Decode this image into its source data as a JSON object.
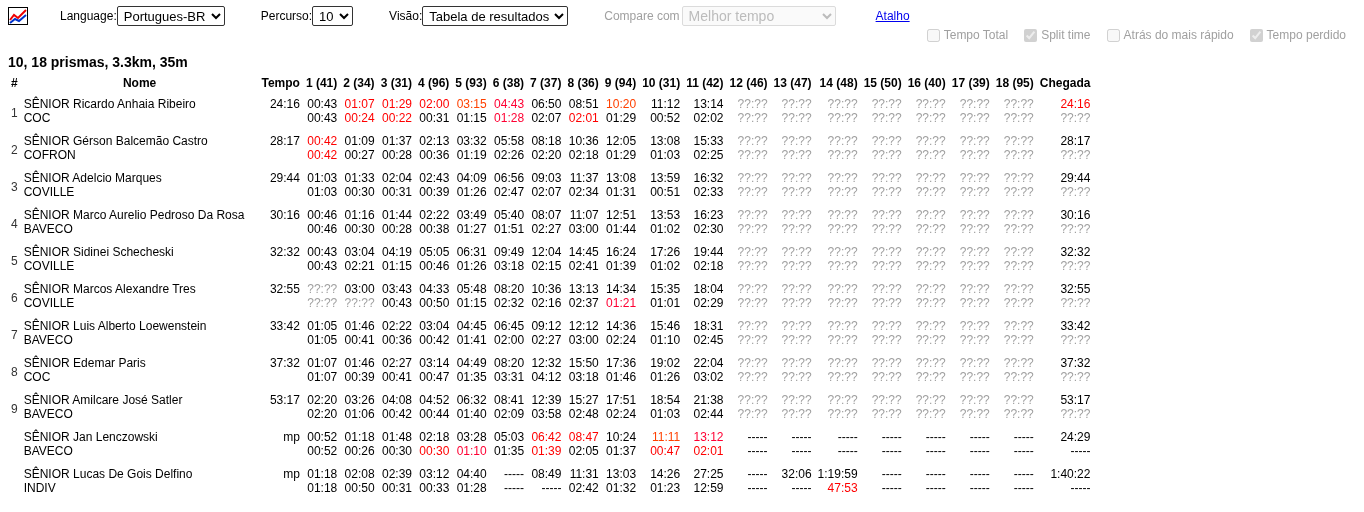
{
  "toolbar": {
    "language": {
      "label": "Language:",
      "value": "Portugues-BR"
    },
    "course": {
      "label": "Percurso:",
      "value": "10"
    },
    "view": {
      "label": "Visão:",
      "value": "Tabela de resultados"
    },
    "compare": {
      "label": "Compare com",
      "value": "Melhor tempo",
      "disabled": true
    },
    "link": "Atalho"
  },
  "options": [
    {
      "label": "Tempo Total",
      "checked": false,
      "disabled": true
    },
    {
      "label": "Split time",
      "checked": true,
      "disabled": true
    },
    {
      "label": "Atrás do mais rápido",
      "checked": false,
      "disabled": true
    },
    {
      "label": "Tempo perdido",
      "checked": true,
      "disabled": true
    }
  ],
  "course_title": "10, 18 prismas, 3.3km, 35m",
  "table": {
    "columns": [
      "#",
      "Nome",
      "Tempo",
      "1 (41)",
      "2 (34)",
      "3 (31)",
      "4 (96)",
      "5 (93)",
      "6 (38)",
      "7 (37)",
      "8 (36)",
      "9 (94)",
      "10 (31)",
      "11 (42)",
      "12 (46)",
      "13 (47)",
      "14 (48)",
      "15 (50)",
      "16 (40)",
      "17 (39)",
      "18 (95)",
      "Chegada"
    ],
    "rows": [
      {
        "rank": "1",
        "name": "SÊNIOR Ricardo Anhaia Ribeiro",
        "club": "COC",
        "time": "24:16",
        "splits": [
          [
            "00:43",
            "00:43"
          ],
          [
            {
              "text": "01:07",
              "color": "#ff0000"
            },
            {
              "text": "00:24",
              "color": "#ff0000"
            }
          ],
          [
            {
              "text": "01:29",
              "color": "#ff0000"
            },
            {
              "text": "00:22",
              "color": "#ff0000"
            }
          ],
          [
            {
              "text": "02:00",
              "color": "#ff0000"
            },
            "00:31"
          ],
          [
            {
              "text": "03:15",
              "color": "#ff4000"
            },
            "01:15"
          ],
          [
            {
              "text": "04:43",
              "color": "#ff0033"
            },
            {
              "text": "01:28",
              "color": "#ff0033"
            }
          ],
          [
            "06:50",
            "02:07"
          ],
          [
            "08:51",
            {
              "text": "02:01",
              "color": "#ff0000"
            }
          ],
          [
            {
              "text": "10:20",
              "color": "#ff4000"
            },
            "01:29"
          ],
          [
            "11:12",
            "00:52"
          ],
          [
            "13:14",
            "02:02"
          ],
          [
            {
              "text": "??:??",
              "color": "#a0a0a0"
            },
            {
              "text": "??:??",
              "color": "#a0a0a0"
            }
          ],
          [
            {
              "text": "??:??",
              "color": "#a0a0a0"
            },
            {
              "text": "??:??",
              "color": "#a0a0a0"
            }
          ],
          [
            {
              "text": "??:??",
              "color": "#a0a0a0"
            },
            {
              "text": "??:??",
              "color": "#a0a0a0"
            }
          ],
          [
            {
              "text": "??:??",
              "color": "#a0a0a0"
            },
            {
              "text": "??:??",
              "color": "#a0a0a0"
            }
          ],
          [
            {
              "text": "??:??",
              "color": "#a0a0a0"
            },
            {
              "text": "??:??",
              "color": "#a0a0a0"
            }
          ],
          [
            {
              "text": "??:??",
              "color": "#a0a0a0"
            },
            {
              "text": "??:??",
              "color": "#a0a0a0"
            }
          ],
          [
            {
              "text": "??:??",
              "color": "#a0a0a0"
            },
            {
              "text": "??:??",
              "color": "#a0a0a0"
            }
          ],
          [
            {
              "text": "24:16",
              "color": "#ff0000"
            },
            {
              "text": "??:??",
              "color": "#a0a0a0"
            }
          ]
        ]
      },
      {
        "rank": "2",
        "name": "SÊNIOR Gérson Balcemão Castro",
        "club": "COFRON",
        "time": "28:17",
        "splits": [
          [
            {
              "text": "00:42",
              "color": "#ff0000"
            },
            {
              "text": "00:42",
              "color": "#ff0000"
            }
          ],
          [
            "01:09",
            "00:27"
          ],
          [
            "01:37",
            "00:28"
          ],
          [
            "02:13",
            "00:36"
          ],
          [
            "03:32",
            "01:19"
          ],
          [
            "05:58",
            "02:26"
          ],
          [
            "08:18",
            "02:20"
          ],
          [
            "10:36",
            "02:18"
          ],
          [
            "12:05",
            "01:29"
          ],
          [
            "13:08",
            "01:03"
          ],
          [
            "15:33",
            "02:25"
          ],
          [
            {
              "text": "??:??",
              "color": "#a0a0a0"
            },
            {
              "text": "??:??",
              "color": "#a0a0a0"
            }
          ],
          [
            {
              "text": "??:??",
              "color": "#a0a0a0"
            },
            {
              "text": "??:??",
              "color": "#a0a0a0"
            }
          ],
          [
            {
              "text": "??:??",
              "color": "#a0a0a0"
            },
            {
              "text": "??:??",
              "color": "#a0a0a0"
            }
          ],
          [
            {
              "text": "??:??",
              "color": "#a0a0a0"
            },
            {
              "text": "??:??",
              "color": "#a0a0a0"
            }
          ],
          [
            {
              "text": "??:??",
              "color": "#a0a0a0"
            },
            {
              "text": "??:??",
              "color": "#a0a0a0"
            }
          ],
          [
            {
              "text": "??:??",
              "color": "#a0a0a0"
            },
            {
              "text": "??:??",
              "color": "#a0a0a0"
            }
          ],
          [
            {
              "text": "??:??",
              "color": "#a0a0a0"
            },
            {
              "text": "??:??",
              "color": "#a0a0a0"
            }
          ],
          [
            "28:17",
            {
              "text": "??:??",
              "color": "#a0a0a0"
            }
          ]
        ]
      },
      {
        "rank": "3",
        "name": "SÊNIOR Adelcio Marques",
        "club": "COVILLE",
        "time": "29:44",
        "splits": [
          [
            "01:03",
            "01:03"
          ],
          [
            "01:33",
            "00:30"
          ],
          [
            "02:04",
            "00:31"
          ],
          [
            "02:43",
            "00:39"
          ],
          [
            "04:09",
            "01:26"
          ],
          [
            "06:56",
            "02:47"
          ],
          [
            "09:03",
            "02:07"
          ],
          [
            "11:37",
            "02:34"
          ],
          [
            "13:08",
            "01:31"
          ],
          [
            "13:59",
            "00:51"
          ],
          [
            "16:32",
            "02:33"
          ],
          [
            {
              "text": "??:??",
              "color": "#a0a0a0"
            },
            {
              "text": "??:??",
              "color": "#a0a0a0"
            }
          ],
          [
            {
              "text": "??:??",
              "color": "#a0a0a0"
            },
            {
              "text": "??:??",
              "color": "#a0a0a0"
            }
          ],
          [
            {
              "text": "??:??",
              "color": "#a0a0a0"
            },
            {
              "text": "??:??",
              "color": "#a0a0a0"
            }
          ],
          [
            {
              "text": "??:??",
              "color": "#a0a0a0"
            },
            {
              "text": "??:??",
              "color": "#a0a0a0"
            }
          ],
          [
            {
              "text": "??:??",
              "color": "#a0a0a0"
            },
            {
              "text": "??:??",
              "color": "#a0a0a0"
            }
          ],
          [
            {
              "text": "??:??",
              "color": "#a0a0a0"
            },
            {
              "text": "??:??",
              "color": "#a0a0a0"
            }
          ],
          [
            {
              "text": "??:??",
              "color": "#a0a0a0"
            },
            {
              "text": "??:??",
              "color": "#a0a0a0"
            }
          ],
          [
            "29:44",
            {
              "text": "??:??",
              "color": "#a0a0a0"
            }
          ]
        ]
      },
      {
        "rank": "4",
        "name": "SÊNIOR Marco Aurelio Pedroso Da Rosa",
        "club": "BAVECO",
        "time": "30:16",
        "splits": [
          [
            "00:46",
            "00:46"
          ],
          [
            "01:16",
            "00:30"
          ],
          [
            "01:44",
            "00:28"
          ],
          [
            "02:22",
            "00:38"
          ],
          [
            "03:49",
            "01:27"
          ],
          [
            "05:40",
            "01:51"
          ],
          [
            "08:07",
            "02:27"
          ],
          [
            "11:07",
            "03:00"
          ],
          [
            "12:51",
            "01:44"
          ],
          [
            "13:53",
            "01:02"
          ],
          [
            "16:23",
            "02:30"
          ],
          [
            {
              "text": "??:??",
              "color": "#a0a0a0"
            },
            {
              "text": "??:??",
              "color": "#a0a0a0"
            }
          ],
          [
            {
              "text": "??:??",
              "color": "#a0a0a0"
            },
            {
              "text": "??:??",
              "color": "#a0a0a0"
            }
          ],
          [
            {
              "text": "??:??",
              "color": "#a0a0a0"
            },
            {
              "text": "??:??",
              "color": "#a0a0a0"
            }
          ],
          [
            {
              "text": "??:??",
              "color": "#a0a0a0"
            },
            {
              "text": "??:??",
              "color": "#a0a0a0"
            }
          ],
          [
            {
              "text": "??:??",
              "color": "#a0a0a0"
            },
            {
              "text": "??:??",
              "color": "#a0a0a0"
            }
          ],
          [
            {
              "text": "??:??",
              "color": "#a0a0a0"
            },
            {
              "text": "??:??",
              "color": "#a0a0a0"
            }
          ],
          [
            {
              "text": "??:??",
              "color": "#a0a0a0"
            },
            {
              "text": "??:??",
              "color": "#a0a0a0"
            }
          ],
          [
            "30:16",
            {
              "text": "??:??",
              "color": "#a0a0a0"
            }
          ]
        ]
      },
      {
        "rank": "5",
        "name": "SÊNIOR Sidinei Schecheski",
        "club": "COVILLE",
        "time": "32:32",
        "splits": [
          [
            "00:43",
            "00:43"
          ],
          [
            "03:04",
            "02:21"
          ],
          [
            "04:19",
            "01:15"
          ],
          [
            "05:05",
            "00:46"
          ],
          [
            "06:31",
            "01:26"
          ],
          [
            "09:49",
            "03:18"
          ],
          [
            "12:04",
            "02:15"
          ],
          [
            "14:45",
            "02:41"
          ],
          [
            "16:24",
            "01:39"
          ],
          [
            "17:26",
            "01:02"
          ],
          [
            "19:44",
            "02:18"
          ],
          [
            {
              "text": "??:??",
              "color": "#a0a0a0"
            },
            {
              "text": "??:??",
              "color": "#a0a0a0"
            }
          ],
          [
            {
              "text": "??:??",
              "color": "#a0a0a0"
            },
            {
              "text": "??:??",
              "color": "#a0a0a0"
            }
          ],
          [
            {
              "text": "??:??",
              "color": "#a0a0a0"
            },
            {
              "text": "??:??",
              "color": "#a0a0a0"
            }
          ],
          [
            {
              "text": "??:??",
              "color": "#a0a0a0"
            },
            {
              "text": "??:??",
              "color": "#a0a0a0"
            }
          ],
          [
            {
              "text": "??:??",
              "color": "#a0a0a0"
            },
            {
              "text": "??:??",
              "color": "#a0a0a0"
            }
          ],
          [
            {
              "text": "??:??",
              "color": "#a0a0a0"
            },
            {
              "text": "??:??",
              "color": "#a0a0a0"
            }
          ],
          [
            {
              "text": "??:??",
              "color": "#a0a0a0"
            },
            {
              "text": "??:??",
              "color": "#a0a0a0"
            }
          ],
          [
            "32:32",
            {
              "text": "??:??",
              "color": "#a0a0a0"
            }
          ]
        ]
      },
      {
        "rank": "6",
        "name": "SÊNIOR Marcos Alexandre Tres",
        "club": "COVILLE",
        "time": "32:55",
        "splits": [
          [
            {
              "text": "??:??",
              "color": "#a0a0a0"
            },
            {
              "text": "??:??",
              "color": "#a0a0a0"
            }
          ],
          [
            "03:00",
            {
              "text": "??:??",
              "color": "#a0a0a0"
            }
          ],
          [
            "03:43",
            "00:43"
          ],
          [
            "04:33",
            "00:50"
          ],
          [
            "05:48",
            "01:15"
          ],
          [
            "08:20",
            "02:32"
          ],
          [
            "10:36",
            "02:16"
          ],
          [
            "13:13",
            "02:37"
          ],
          [
            "14:34",
            {
              "text": "01:21",
              "color": "#ff0033"
            }
          ],
          [
            "15:35",
            "01:01"
          ],
          [
            "18:04",
            "02:29"
          ],
          [
            {
              "text": "??:??",
              "color": "#a0a0a0"
            },
            {
              "text": "??:??",
              "color": "#a0a0a0"
            }
          ],
          [
            {
              "text": "??:??",
              "color": "#a0a0a0"
            },
            {
              "text": "??:??",
              "color": "#a0a0a0"
            }
          ],
          [
            {
              "text": "??:??",
              "color": "#a0a0a0"
            },
            {
              "text": "??:??",
              "color": "#a0a0a0"
            }
          ],
          [
            {
              "text": "??:??",
              "color": "#a0a0a0"
            },
            {
              "text": "??:??",
              "color": "#a0a0a0"
            }
          ],
          [
            {
              "text": "??:??",
              "color": "#a0a0a0"
            },
            {
              "text": "??:??",
              "color": "#a0a0a0"
            }
          ],
          [
            {
              "text": "??:??",
              "color": "#a0a0a0"
            },
            {
              "text": "??:??",
              "color": "#a0a0a0"
            }
          ],
          [
            {
              "text": "??:??",
              "color": "#a0a0a0"
            },
            {
              "text": "??:??",
              "color": "#a0a0a0"
            }
          ],
          [
            "32:55",
            {
              "text": "??:??",
              "color": "#a0a0a0"
            }
          ]
        ]
      },
      {
        "rank": "7",
        "name": "SÊNIOR Luis Alberto Loewenstein",
        "club": "BAVECO",
        "time": "33:42",
        "splits": [
          [
            "01:05",
            "01:05"
          ],
          [
            "01:46",
            "00:41"
          ],
          [
            "02:22",
            "00:36"
          ],
          [
            "03:04",
            "00:42"
          ],
          [
            "04:45",
            "01:41"
          ],
          [
            "06:45",
            "02:00"
          ],
          [
            "09:12",
            "02:27"
          ],
          [
            "12:12",
            "03:00"
          ],
          [
            "14:36",
            "02:24"
          ],
          [
            "15:46",
            "01:10"
          ],
          [
            "18:31",
            "02:45"
          ],
          [
            {
              "text": "??:??",
              "color": "#a0a0a0"
            },
            {
              "text": "??:??",
              "color": "#a0a0a0"
            }
          ],
          [
            {
              "text": "??:??",
              "color": "#a0a0a0"
            },
            {
              "text": "??:??",
              "color": "#a0a0a0"
            }
          ],
          [
            {
              "text": "??:??",
              "color": "#a0a0a0"
            },
            {
              "text": "??:??",
              "color": "#a0a0a0"
            }
          ],
          [
            {
              "text": "??:??",
              "color": "#a0a0a0"
            },
            {
              "text": "??:??",
              "color": "#a0a0a0"
            }
          ],
          [
            {
              "text": "??:??",
              "color": "#a0a0a0"
            },
            {
              "text": "??:??",
              "color": "#a0a0a0"
            }
          ],
          [
            {
              "text": "??:??",
              "color": "#a0a0a0"
            },
            {
              "text": "??:??",
              "color": "#a0a0a0"
            }
          ],
          [
            {
              "text": "??:??",
              "color": "#a0a0a0"
            },
            {
              "text": "??:??",
              "color": "#a0a0a0"
            }
          ],
          [
            "33:42",
            {
              "text": "??:??",
              "color": "#a0a0a0"
            }
          ]
        ]
      },
      {
        "rank": "8",
        "name": "SÊNIOR Edemar Paris",
        "club": "COC",
        "time": "37:32",
        "splits": [
          [
            "01:07",
            "01:07"
          ],
          [
            "01:46",
            "00:39"
          ],
          [
            "02:27",
            "00:41"
          ],
          [
            "03:14",
            "00:47"
          ],
          [
            "04:49",
            "01:35"
          ],
          [
            "08:20",
            "03:31"
          ],
          [
            "12:32",
            "04:12"
          ],
          [
            "15:50",
            "03:18"
          ],
          [
            "17:36",
            "01:46"
          ],
          [
            "19:02",
            "01:26"
          ],
          [
            "22:04",
            "03:02"
          ],
          [
            {
              "text": "??:??",
              "color": "#a0a0a0"
            },
            {
              "text": "??:??",
              "color": "#a0a0a0"
            }
          ],
          [
            {
              "text": "??:??",
              "color": "#a0a0a0"
            },
            {
              "text": "??:??",
              "color": "#a0a0a0"
            }
          ],
          [
            {
              "text": "??:??",
              "color": "#a0a0a0"
            },
            {
              "text": "??:??",
              "color": "#a0a0a0"
            }
          ],
          [
            {
              "text": "??:??",
              "color": "#a0a0a0"
            },
            {
              "text": "??:??",
              "color": "#a0a0a0"
            }
          ],
          [
            {
              "text": "??:??",
              "color": "#a0a0a0"
            },
            {
              "text": "??:??",
              "color": "#a0a0a0"
            }
          ],
          [
            {
              "text": "??:??",
              "color": "#a0a0a0"
            },
            {
              "text": "??:??",
              "color": "#a0a0a0"
            }
          ],
          [
            {
              "text": "??:??",
              "color": "#a0a0a0"
            },
            {
              "text": "??:??",
              "color": "#a0a0a0"
            }
          ],
          [
            "37:32",
            {
              "text": "??:??",
              "color": "#a0a0a0"
            }
          ]
        ]
      },
      {
        "rank": "9",
        "name": "SÊNIOR Amilcare José Satler",
        "club": "BAVECO",
        "time": "53:17",
        "splits": [
          [
            "02:20",
            "02:20"
          ],
          [
            "03:26",
            "01:06"
          ],
          [
            "04:08",
            "00:42"
          ],
          [
            "04:52",
            "00:44"
          ],
          [
            "06:32",
            "01:40"
          ],
          [
            "08:41",
            "02:09"
          ],
          [
            "12:39",
            "03:58"
          ],
          [
            "15:27",
            "02:48"
          ],
          [
            "17:51",
            "02:24"
          ],
          [
            "18:54",
            "01:03"
          ],
          [
            "21:38",
            "02:44"
          ],
          [
            {
              "text": "??:??",
              "color": "#a0a0a0"
            },
            {
              "text": "??:??",
              "color": "#a0a0a0"
            }
          ],
          [
            {
              "text": "??:??",
              "color": "#a0a0a0"
            },
            {
              "text": "??:??",
              "color": "#a0a0a0"
            }
          ],
          [
            {
              "text": "??:??",
              "color": "#a0a0a0"
            },
            {
              "text": "??:??",
              "color": "#a0a0a0"
            }
          ],
          [
            {
              "text": "??:??",
              "color": "#a0a0a0"
            },
            {
              "text": "??:??",
              "color": "#a0a0a0"
            }
          ],
          [
            {
              "text": "??:??",
              "color": "#a0a0a0"
            },
            {
              "text": "??:??",
              "color": "#a0a0a0"
            }
          ],
          [
            {
              "text": "??:??",
              "color": "#a0a0a0"
            },
            {
              "text": "??:??",
              "color": "#a0a0a0"
            }
          ],
          [
            {
              "text": "??:??",
              "color": "#a0a0a0"
            },
            {
              "text": "??:??",
              "color": "#a0a0a0"
            }
          ],
          [
            "53:17",
            {
              "text": "??:??",
              "color": "#a0a0a0"
            }
          ]
        ]
      },
      {
        "name": "SÊNIOR Jan Lenczowski",
        "club": "BAVECO",
        "time": "mp",
        "splits": [
          [
            "00:52",
            "00:52"
          ],
          [
            "01:18",
            "00:26"
          ],
          [
            "01:48",
            "00:30"
          ],
          [
            "02:18",
            {
              "text": "00:30",
              "color": "#ff0000"
            }
          ],
          [
            "03:28",
            {
              "text": "01:10",
              "color": "#ff0033"
            }
          ],
          [
            "05:03",
            "01:35"
          ],
          [
            {
              "text": "06:42",
              "color": "#ff0000"
            },
            {
              "text": "01:39",
              "color": "#ff0000"
            }
          ],
          [
            {
              "text": "08:47",
              "color": "#ff0000"
            },
            "02:05"
          ],
          [
            "10:24",
            "01:37"
          ],
          [
            {
              "text": "11:11",
              "color": "#ff4000"
            },
            {
              "text": "00:47",
              "color": "#ff0000"
            }
          ],
          [
            {
              "text": "13:12",
              "color": "#ff0033"
            },
            {
              "text": "02:01",
              "color": "#ff0000"
            }
          ],
          [
            "-----",
            "-----"
          ],
          [
            "-----",
            "-----"
          ],
          [
            "-----",
            "-----"
          ],
          [
            "-----",
            "-----"
          ],
          [
            "-----",
            "-----"
          ],
          [
            "-----",
            "-----"
          ],
          [
            "-----",
            "-----"
          ],
          [
            "24:29",
            "-----"
          ]
        ]
      },
      {
        "name": "SÊNIOR Lucas De Gois Delfino",
        "club": "INDIV",
        "time": "mp",
        "splits": [
          [
            "01:18",
            "01:18"
          ],
          [
            "02:08",
            "00:50"
          ],
          [
            "02:39",
            "00:31"
          ],
          [
            "03:12",
            "00:33"
          ],
          [
            "04:40",
            "01:28"
          ],
          [
            "-----",
            "-----"
          ],
          [
            "08:49",
            "-----"
          ],
          [
            "11:31",
            "02:42"
          ],
          [
            "13:03",
            "01:32"
          ],
          [
            "14:26",
            "01:23"
          ],
          [
            "27:25",
            "12:59"
          ],
          [
            "-----",
            "-----"
          ],
          [
            "32:06",
            "-----"
          ],
          [
            "1:19:59",
            {
              "text": "47:53",
              "color": "#ff0000"
            }
          ],
          [
            "-----",
            "-----"
          ],
          [
            "-----",
            "-----"
          ],
          [
            "-----",
            "-----"
          ],
          [
            "-----",
            "-----"
          ],
          [
            "1:40:22",
            "-----"
          ]
        ]
      }
    ]
  }
}
